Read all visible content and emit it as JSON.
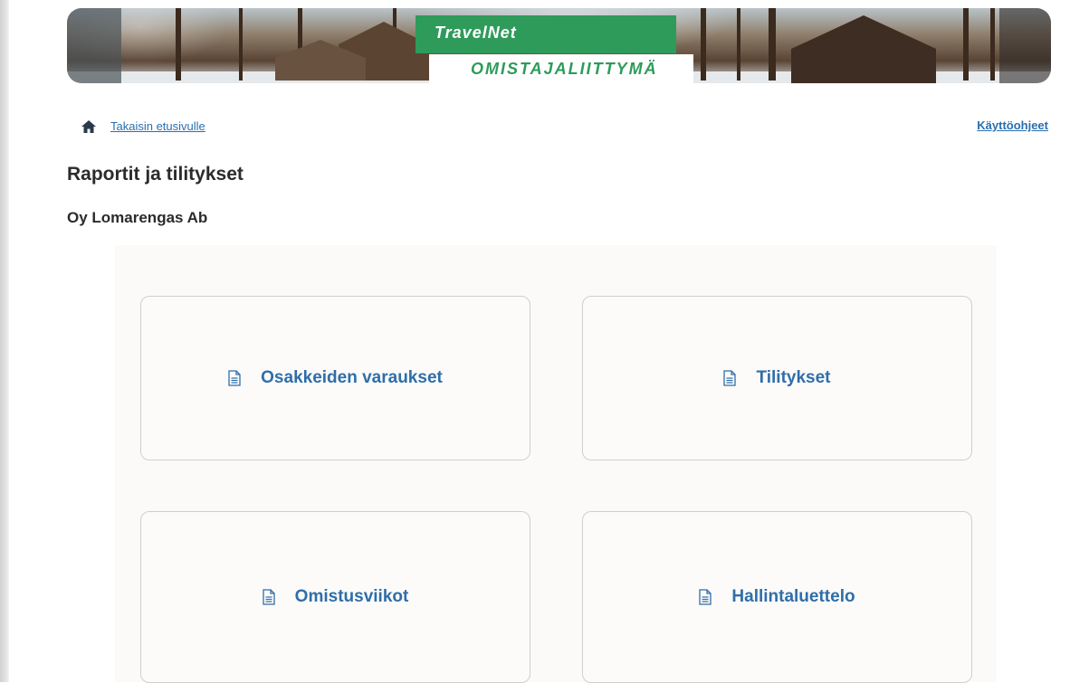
{
  "banner": {
    "brand_title": "TravelNet",
    "brand_subtitle": "OMISTAJALIITTYMÄ",
    "brand_color": "#2e9b5a"
  },
  "nav": {
    "home_icon": "home-icon",
    "home_label": "Takaisin etusivulle",
    "help_label": "Käyttöohjeet",
    "link_color": "#2a6fb0"
  },
  "page": {
    "title": "Raportit ja tilitykset",
    "company": "Oy Lomarengas Ab"
  },
  "tiles": [
    {
      "icon": "document-icon",
      "label": "Osakkeiden varaukset"
    },
    {
      "icon": "document-icon",
      "label": "Tilitykset"
    },
    {
      "icon": "document-icon",
      "label": "Omistusviikot"
    },
    {
      "icon": "document-icon",
      "label": "Hallintaluettelo"
    }
  ]
}
